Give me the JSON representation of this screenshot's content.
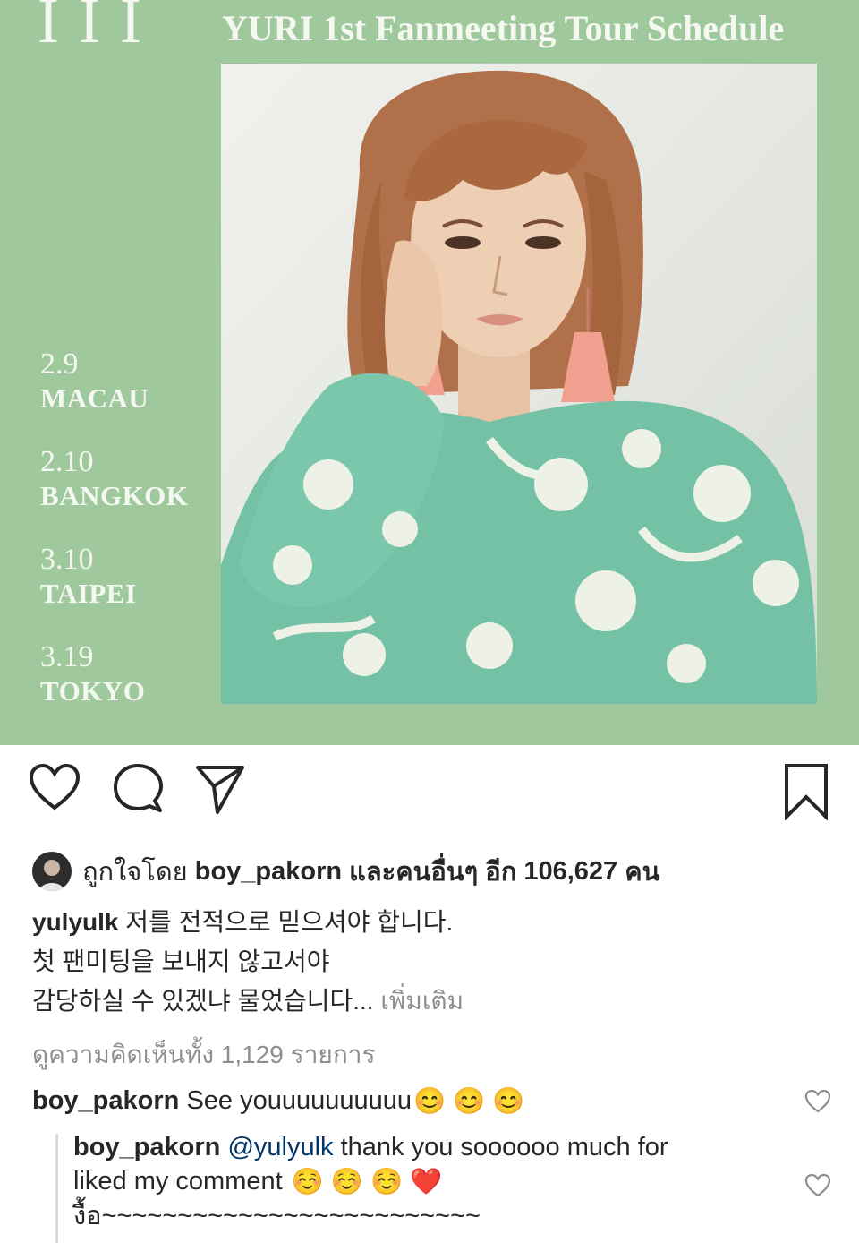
{
  "post": {
    "logo_text": "I I I",
    "poster_title": "YURI 1st Fanmeeting Tour Schedule",
    "schedule": [
      {
        "date": "2.9",
        "city": "MACAU"
      },
      {
        "date": "2.10",
        "city": "BANGKOK"
      },
      {
        "date": "3.10",
        "city": "TAIPEI"
      },
      {
        "date": "3.19",
        "city": "TOKYO"
      }
    ],
    "bg_color": "#9fc89c"
  },
  "actions": {
    "icons": [
      "heart-icon",
      "comment-icon",
      "share-icon",
      "bookmark-icon"
    ]
  },
  "likes": {
    "prefix": "ถูกใจโดย",
    "user": "boy_pakorn",
    "middle": "และคนอื่นๆ อีก",
    "count": "106,627",
    "suffix": "คน"
  },
  "caption": {
    "username": "yulyulk",
    "line1": "저를  전적으로 믿으셔야 합니다.",
    "line2": "첫 팬미팅을 보내지 않고서야",
    "line3": "감당하실 수 있겠냐 물었습니다...",
    "more": "เพิ่มเติม"
  },
  "comments": {
    "view_all": "ดูความคิดเห็นทั้ง 1,129 รายการ",
    "items": [
      {
        "username": "boy_pakorn",
        "text": "See youuuuuuuuuu",
        "emojis": [
          "😊",
          "😊",
          "😊"
        ]
      },
      {
        "username": "boy_pakorn",
        "mention": "@yulyulk",
        "text": "thank you soooooo much for",
        "line2": "liked my comment",
        "emojis": [
          "☺️",
          "☺️",
          "☺️",
          "❤️"
        ],
        "line3": "งื้อ~~~~~~~~~~~~~~~~~~~~~~~~~"
      }
    ]
  }
}
